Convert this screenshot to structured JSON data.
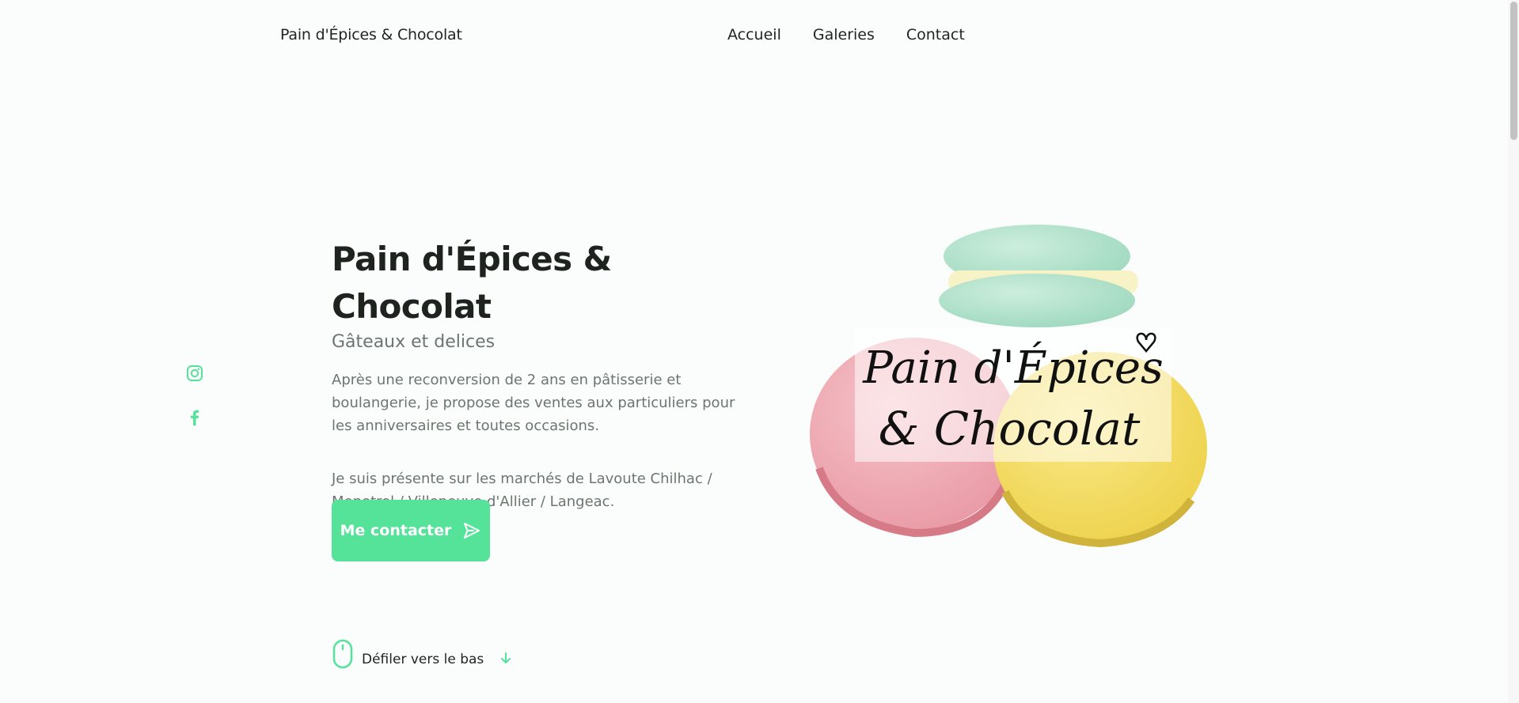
{
  "header": {
    "logo": "Pain d'Épices & Chocolat",
    "nav": [
      "Accueil",
      "Galeries",
      "Contact"
    ]
  },
  "social": {
    "icons": [
      "instagram-icon",
      "facebook-icon"
    ],
    "color": "#55e299"
  },
  "hero": {
    "title": "Pain d'Épices & Chocolat",
    "subtitle": "Gâteaux et delices",
    "description": "Après une reconversion de 2 ans en pâtisserie et boulangerie, je propose des ventes aux particuliers pour les anniversaires et toutes occasions.",
    "description2": "Je suis présente sur les marchés de Lavoute Chilhac / Menetrol / Villeneuve d'Allier / Langeac.",
    "cta_label": "Me contacter",
    "cta_icon": "send-icon",
    "image_caption_line1": "Pain d'Épices",
    "image_caption_line2": "& Chocolat"
  },
  "scroll": {
    "label": "Défiler vers le bas",
    "icons": [
      "mouse-icon",
      "arrow-down-icon"
    ]
  },
  "colors": {
    "accent": "#55e299",
    "text_dark": "#1e2320",
    "text_muted": "#6c7670",
    "background": "#fbfdfc"
  }
}
